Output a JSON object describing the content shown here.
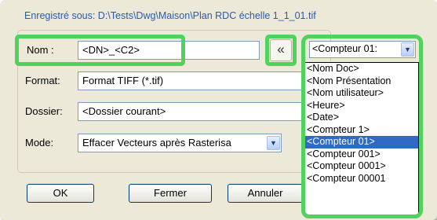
{
  "dialog": {
    "saved_as": "Enregistré sous: D:\\Tests\\Dwg\\Maison\\Plan RDC échelle 1_1_01.tif"
  },
  "form": {
    "name_label": "Nom :",
    "name_value": "<DN>_<C2>",
    "format_label": "Format:",
    "format_value": "Format TIFF (*.tif)",
    "folder_label": "Dossier:",
    "folder_value": "<Dossier courant>",
    "mode_label": "Mode:",
    "mode_value": "Effacer Vecteurs après Rasterisa"
  },
  "insert_button": {
    "label": "«"
  },
  "combo": {
    "selected": "<Compteur 01:"
  },
  "dropdown": {
    "items": [
      "<Nom Doc>",
      "<Nom Présentation",
      "<Nom utilisateur>",
      "<Heure>",
      "<Date>",
      "<Compteur 1>",
      "<Compteur 01>",
      "<Compteur 001>",
      "<Compteur 0001>",
      "<Compteur 00001"
    ],
    "selected_index": 6
  },
  "buttons": {
    "ok": "OK",
    "close": "Fermer",
    "cancel": "Annuler"
  },
  "colors": {
    "highlight_frame": "#4fd25e",
    "selection": "#316ac5",
    "saved_as_text": "#2a5ab0"
  }
}
